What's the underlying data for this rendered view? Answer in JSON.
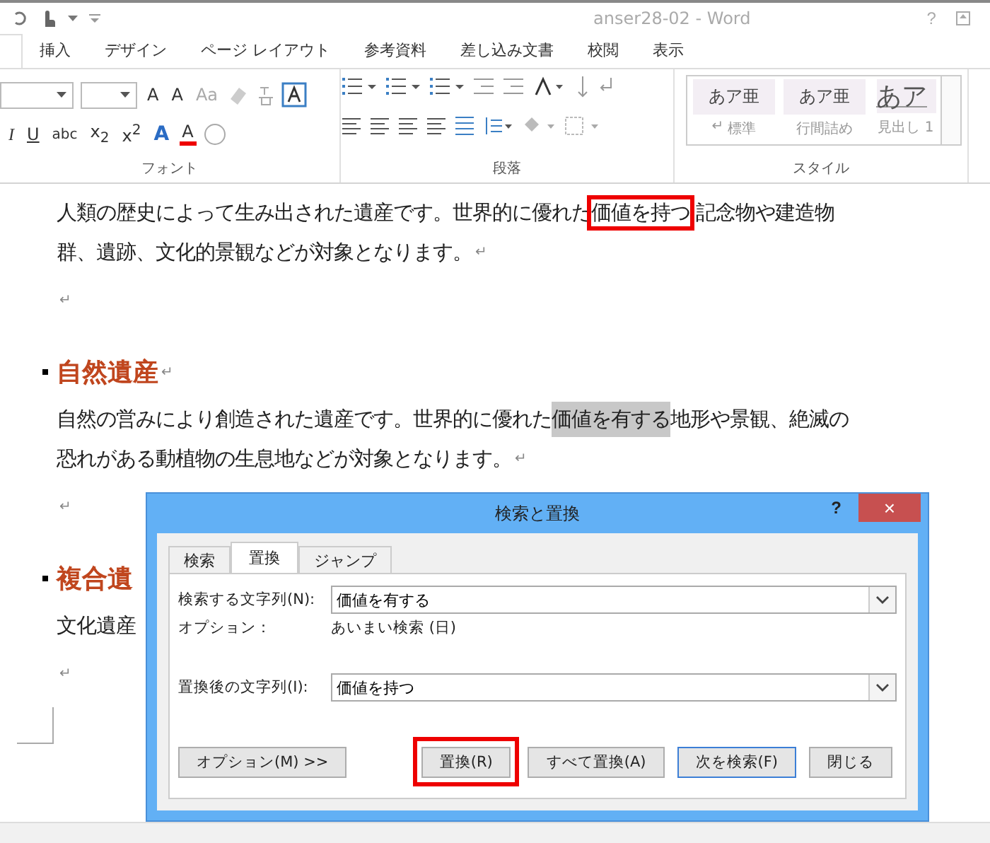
{
  "window": {
    "title": "anser28-02 - Word",
    "help": "?"
  },
  "tabs": [
    {
      "label": "挿入",
      "selected": false
    },
    {
      "label": "デザイン",
      "selected": false
    },
    {
      "label": "ページ レイアウト",
      "selected": false
    },
    {
      "label": "参考資料",
      "selected": false
    },
    {
      "label": "差し込み文書",
      "selected": false
    },
    {
      "label": "校閲",
      "selected": false
    },
    {
      "label": "表示",
      "selected": false
    }
  ],
  "ribbon": {
    "font_row1": [
      "A",
      "A",
      "Aa"
    ],
    "font_row2": [
      "I",
      "U",
      "abc",
      "x$_{2}$",
      "x$^{2}$",
      "A",
      "A"
    ],
    "groups": [
      "フォント",
      "段落",
      "スタイル"
    ],
    "styles": [
      {
        "sample": "あア亜",
        "name": "標準",
        "mark": "↵",
        "kind": "small"
      },
      {
        "sample": "あア亜",
        "name": "行間詰め",
        "kind": "small"
      },
      {
        "sample": "あア",
        "name": "見出し 1",
        "kind": "large"
      }
    ]
  },
  "document": [
    {
      "kind": "para",
      "lines": [
        [
          {
            "text": "人類の歴史によって生み出された遺産です。世界的に優れた",
            "kind": "plain"
          },
          {
            "text": "価値を持つ",
            "kind": "boxed"
          },
          {
            "text": "記念物や建造物",
            "kind": "plain"
          }
        ],
        [
          {
            "text": "群、遺跡、文化的景観などが対象となります。",
            "kind": "plain"
          }
        ]
      ],
      "mark": "↵"
    },
    {
      "kind": "empty",
      "mark": "↵"
    },
    {
      "kind": "heading",
      "text": "自然遺産",
      "mark": "↵"
    },
    {
      "kind": "para",
      "lines": [
        [
          {
            "text": "自然の営みにより創造された遺産です。世界的に優れた",
            "kind": "plain"
          },
          {
            "text": "価値を有する",
            "kind": "highlight"
          },
          {
            "text": "地形や景観、絶滅の",
            "kind": "plain"
          }
        ],
        [
          {
            "text": "恐れがある動植物の生息地などが対象となります。",
            "kind": "plain"
          }
        ]
      ],
      "mark": "↵"
    },
    {
      "kind": "empty",
      "mark": "↵"
    },
    {
      "kind": "heading",
      "text": "複合遺"
    },
    {
      "kind": "para",
      "lines": [
        [
          {
            "text": "文化遺産",
            "kind": "plain"
          }
        ]
      ]
    },
    {
      "kind": "empty",
      "mark": "↵"
    }
  ],
  "dialog": {
    "title": "検索と置換",
    "help": "?",
    "close": "×",
    "tabs": [
      {
        "label": "検索",
        "selected": false
      },
      {
        "label": "置換",
        "selected": true
      },
      {
        "label": "ジャンプ",
        "selected": false
      }
    ],
    "find": {
      "label": "検索する文字列(N):",
      "value": "価値を有する"
    },
    "options": {
      "label": "オプション：",
      "value": "あいまい検索 (日)"
    },
    "replace": {
      "label": "置換後の文字列(I):",
      "value": "価値を持つ"
    },
    "buttons": [
      {
        "label": "オプション(M) >>",
        "kind": "options"
      },
      {
        "label": "置換(R)",
        "kind": "action",
        "highlighted": true,
        "default": false
      },
      {
        "label": "すべて置換(A)",
        "kind": "action",
        "highlighted": false,
        "default": false
      },
      {
        "label": "次を検索(F)",
        "kind": "action",
        "highlighted": false,
        "default": true
      },
      {
        "label": "閉じる",
        "kind": "action",
        "highlighted": false,
        "default": false
      }
    ]
  }
}
